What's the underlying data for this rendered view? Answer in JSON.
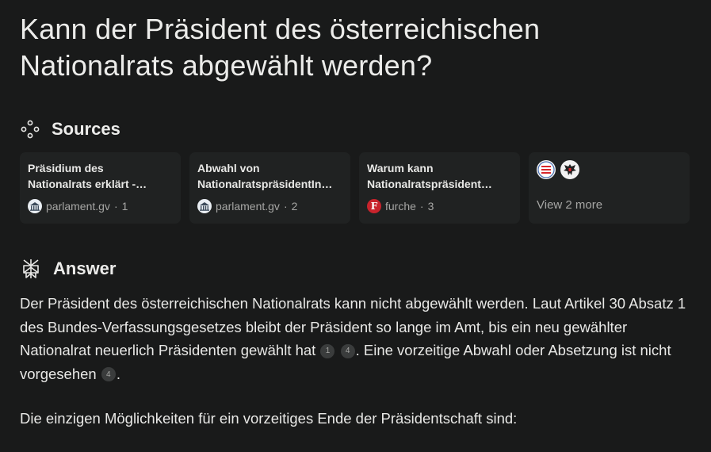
{
  "question": {
    "line1": "Kann der Präsident des österreichischen",
    "line2": "Nationalrats abgewählt werden?"
  },
  "sources": {
    "heading": "Sources",
    "cards": [
      {
        "title_line1": "Präsidium des",
        "title_line2": "Nationalrats erklärt -…",
        "domain": "parlament.gv",
        "index": "1",
        "favicon": "parliament-icon"
      },
      {
        "title_line1": "Abwahl von",
        "title_line2": "NationalratspräsidentIn…",
        "domain": "parlament.gv",
        "index": "2",
        "favicon": "parliament-icon"
      },
      {
        "title_line1": "Warum kann",
        "title_line2": "Nationalratspräsident…",
        "domain": "furche",
        "index": "3",
        "favicon": "furche-icon",
        "favicon_letter": "F"
      }
    ],
    "more_label": "View 2 more",
    "more_icons": [
      "flag-icon",
      "eagle-icon"
    ]
  },
  "answer": {
    "heading": "Answer",
    "p1_part1": "Der Präsident des österreichischen Nationalrats kann nicht abgewählt werden. Laut Artikel 30 Absatz 1 des Bundes-Verfassungsgesetzes bleibt der Präsident so lange im Amt, bis ein neu gewählter Nationalrat neuerlich Präsidenten gewählt hat",
    "cite_a": "1",
    "cite_b": "4",
    "p1_part2": ". Eine vorzeitige Abwahl oder Absetzung ist nicht vorgesehen",
    "cite_c": "4",
    "p1_part3": ".",
    "p2": "Die einzigen Möglichkeiten für ein vorzeitiges Ende der Präsidentschaft sind:"
  },
  "colors": {
    "background": "#191a1a",
    "card": "#202222",
    "text": "#e8e8e6",
    "muted": "#a6a6a4"
  }
}
